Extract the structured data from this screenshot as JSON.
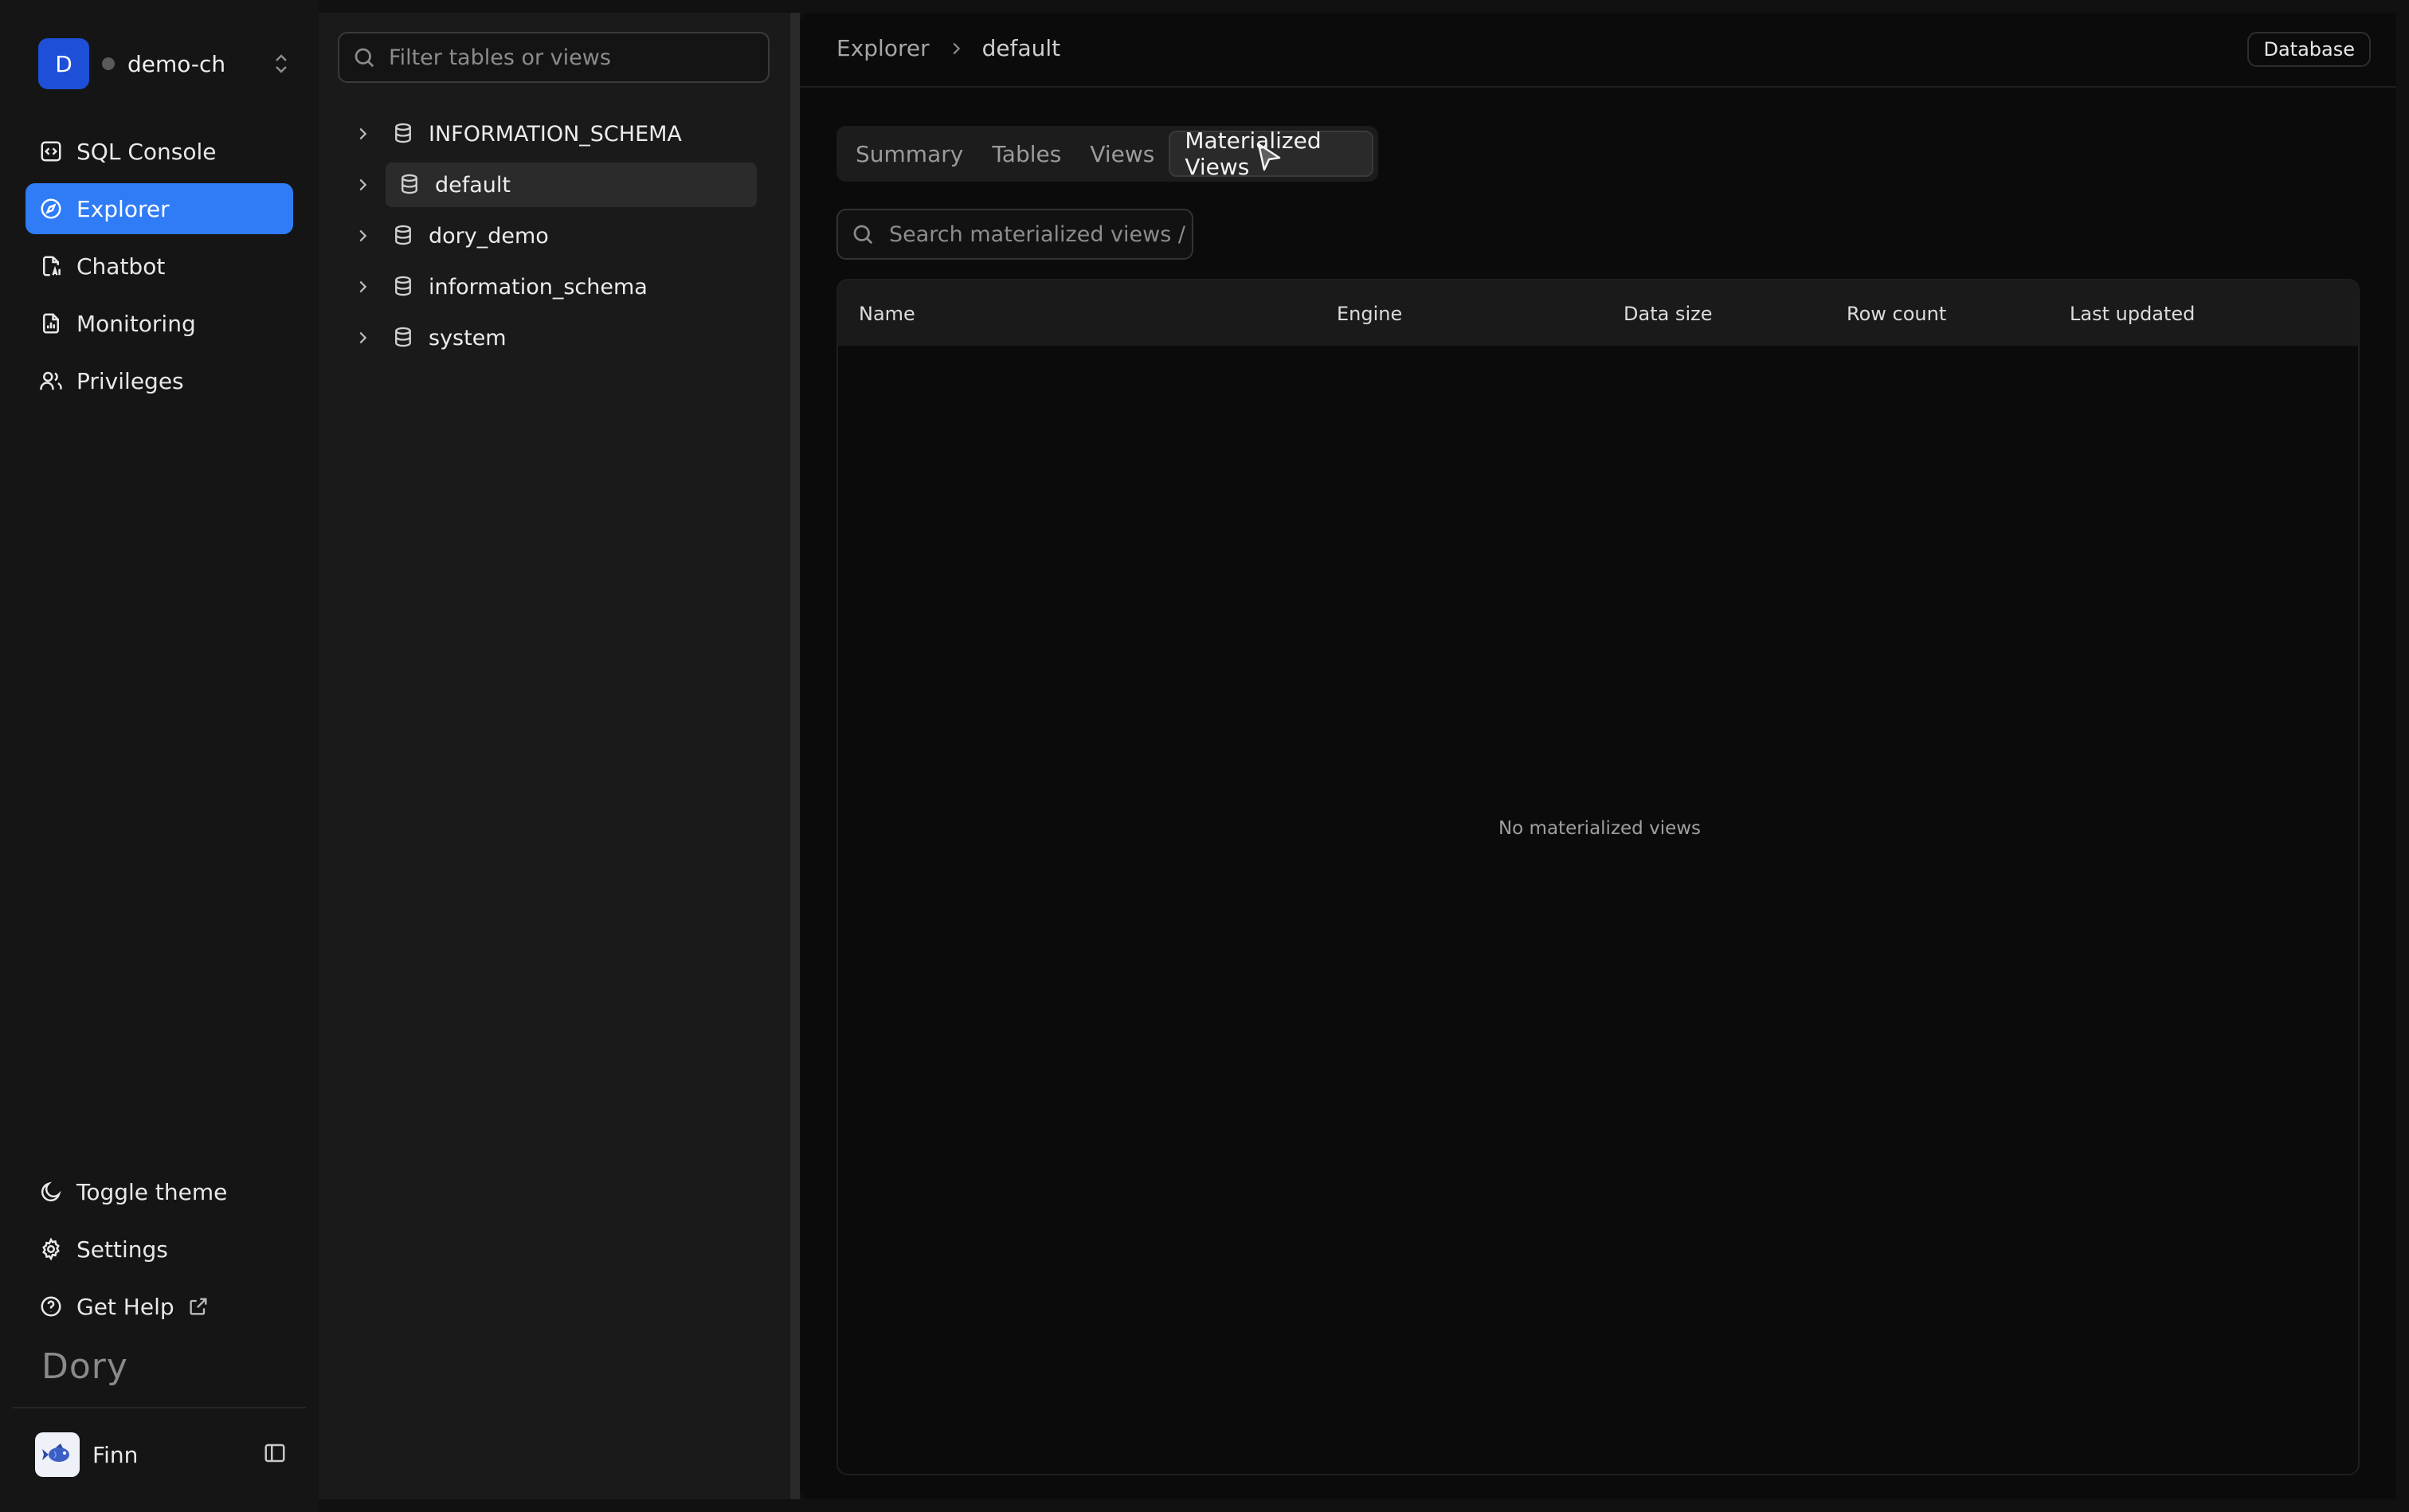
{
  "workspace": {
    "initial": "D",
    "name": "demo-ch"
  },
  "nav": {
    "items": [
      {
        "label": "SQL Console",
        "icon": "code-square-icon"
      },
      {
        "label": "Explorer",
        "icon": "compass-icon",
        "active": true
      },
      {
        "label": "Chatbot",
        "icon": "ai-doc-icon"
      },
      {
        "label": "Monitoring",
        "icon": "chart-doc-icon"
      },
      {
        "label": "Privileges",
        "icon": "users-icon"
      }
    ],
    "bottom": [
      {
        "label": "Toggle theme",
        "icon": "moon-icon"
      },
      {
        "label": "Settings",
        "icon": "gear-icon"
      },
      {
        "label": "Get Help",
        "icon": "help-circle-icon"
      }
    ],
    "brand": "Dory",
    "user": {
      "name": "Finn"
    }
  },
  "tree": {
    "filter_placeholder": "Filter tables or views",
    "items": [
      {
        "label": "INFORMATION_SCHEMA"
      },
      {
        "label": "default",
        "selected": true
      },
      {
        "label": "dory_demo"
      },
      {
        "label": "information_schema"
      },
      {
        "label": "system"
      }
    ]
  },
  "header": {
    "breadcrumb": [
      "Explorer",
      "default"
    ],
    "scope_badge": "Database"
  },
  "tabs": [
    "Summary",
    "Tables",
    "Views",
    "Materialized Views"
  ],
  "active_tab": "Materialized Views",
  "search": {
    "placeholder": "Search materialized views /"
  },
  "table": {
    "columns": [
      "Name",
      "Engine",
      "Data size",
      "Row count",
      "Last updated"
    ],
    "empty_text": "No materialized views"
  },
  "colors": {
    "accent": "#2f7cf6",
    "workspace_avatar": "#1e4fd8",
    "background": "#0b0b0b"
  }
}
